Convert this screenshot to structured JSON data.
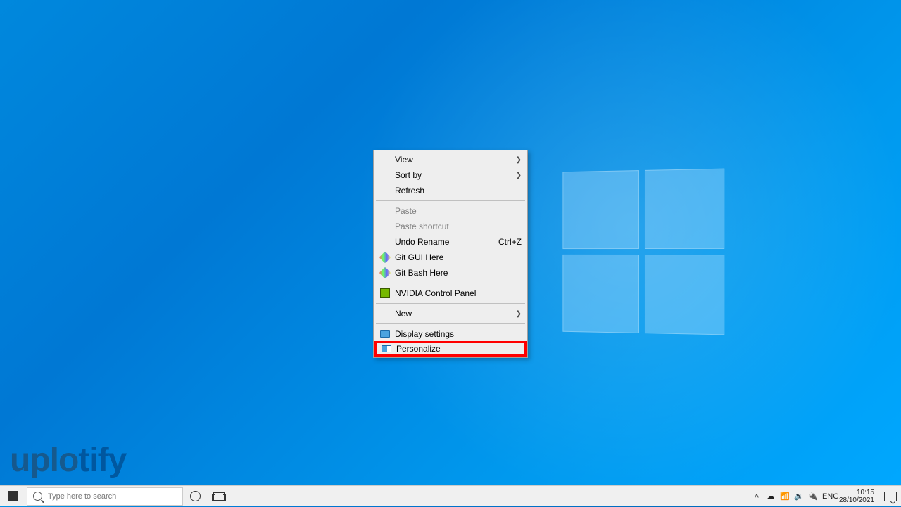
{
  "watermark": {
    "prefix": "uplo",
    "suffix": "tify"
  },
  "context_menu": {
    "items": [
      {
        "label": "View",
        "submenu": true
      },
      {
        "label": "Sort by",
        "submenu": true
      },
      {
        "label": "Refresh"
      }
    ],
    "paste_group": [
      {
        "label": "Paste",
        "disabled": true
      },
      {
        "label": "Paste shortcut",
        "disabled": true
      },
      {
        "label": "Undo Rename",
        "shortcut": "Ctrl+Z"
      }
    ],
    "git_group": [
      {
        "label": "Git GUI Here"
      },
      {
        "label": "Git Bash Here"
      }
    ],
    "nvidia": {
      "label": "NVIDIA Control Panel"
    },
    "new": {
      "label": "New",
      "submenu": true
    },
    "settings_group": [
      {
        "label": "Display settings"
      },
      {
        "label": "Personalize",
        "highlighted": true
      }
    ]
  },
  "taskbar": {
    "search_placeholder": "Type here to search",
    "tray": {
      "lang": "ENG",
      "time": "10:15",
      "date": "28/10/2021"
    }
  }
}
